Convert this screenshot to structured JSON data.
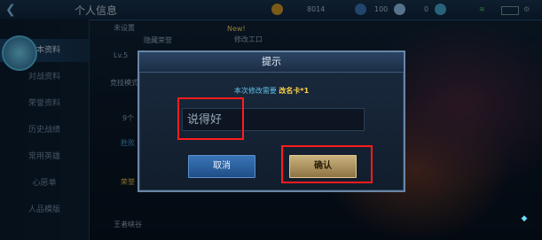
{
  "header": {
    "title": "个人信息",
    "gold": "8014",
    "coupons": "100",
    "diamonds": "0"
  },
  "sidebar": {
    "items": [
      {
        "label": "基本资料",
        "active": true
      },
      {
        "label": "对战资料"
      },
      {
        "label": "荣誉资料"
      },
      {
        "label": "历史战绩"
      },
      {
        "label": "常用英雄"
      },
      {
        "label": "心愿单"
      },
      {
        "label": "人品模版"
      }
    ]
  },
  "background_fragments": {
    "friends": "未设置",
    "hide": "隐藏荣誉",
    "new_badge": "New!",
    "edit_tag": "修改工口",
    "level": "Lv.5",
    "win_tab": "竞技模式",
    "games": "9个",
    "series": "胜败",
    "honor": "荣誉",
    "ally": "王者峡谷"
  },
  "modal": {
    "title": "提示",
    "prompt_prefix": "本次修改需要",
    "prompt_card": "改名卡*1",
    "input_value": "说得好",
    "cancel_label": "取消",
    "confirm_label": "确认"
  },
  "colors": {
    "prompt": "#5fc1e8",
    "card": "#ffd34a",
    "highlight": "#ff1c1c"
  }
}
